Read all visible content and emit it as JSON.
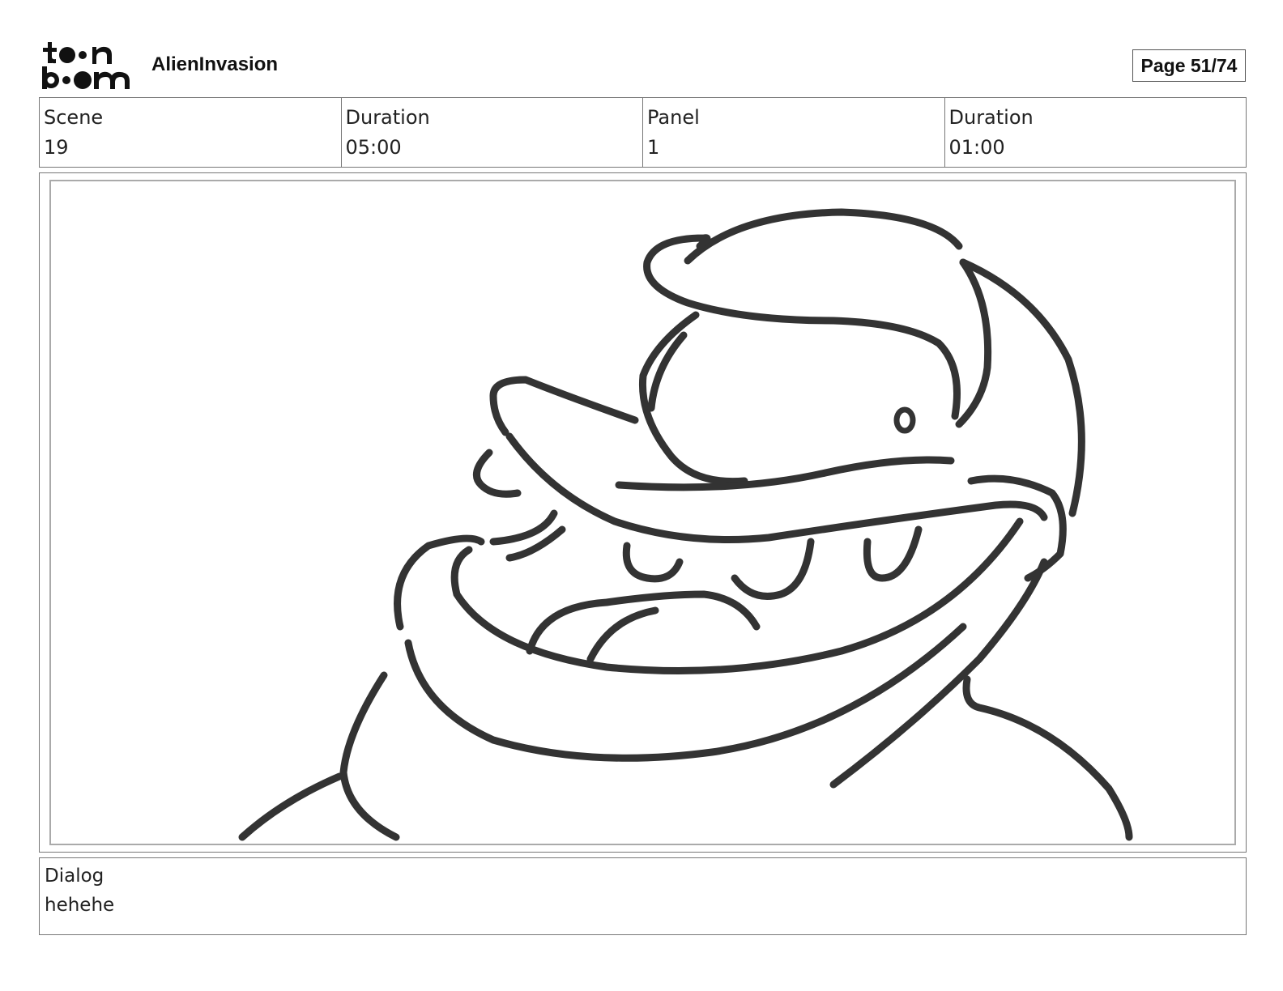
{
  "header": {
    "logo_icon": "toon-boom-logo-icon",
    "logo_text_top": "toon",
    "logo_text_bottom": "boom",
    "project_title": "AlienInvasion",
    "page_label": "Page 51/74"
  },
  "info": {
    "scene_label": "Scene",
    "scene_value": "19",
    "scene_duration_label": "Duration",
    "scene_duration_value": "05:00",
    "panel_label": "Panel",
    "panel_value": "1",
    "panel_duration_label": "Duration",
    "panel_duration_value": "01:00"
  },
  "panel": {
    "image_icon": "character-sketch-icon",
    "line_color": "#333333"
  },
  "dialog": {
    "label": "Dialog",
    "text": "hehehe"
  }
}
